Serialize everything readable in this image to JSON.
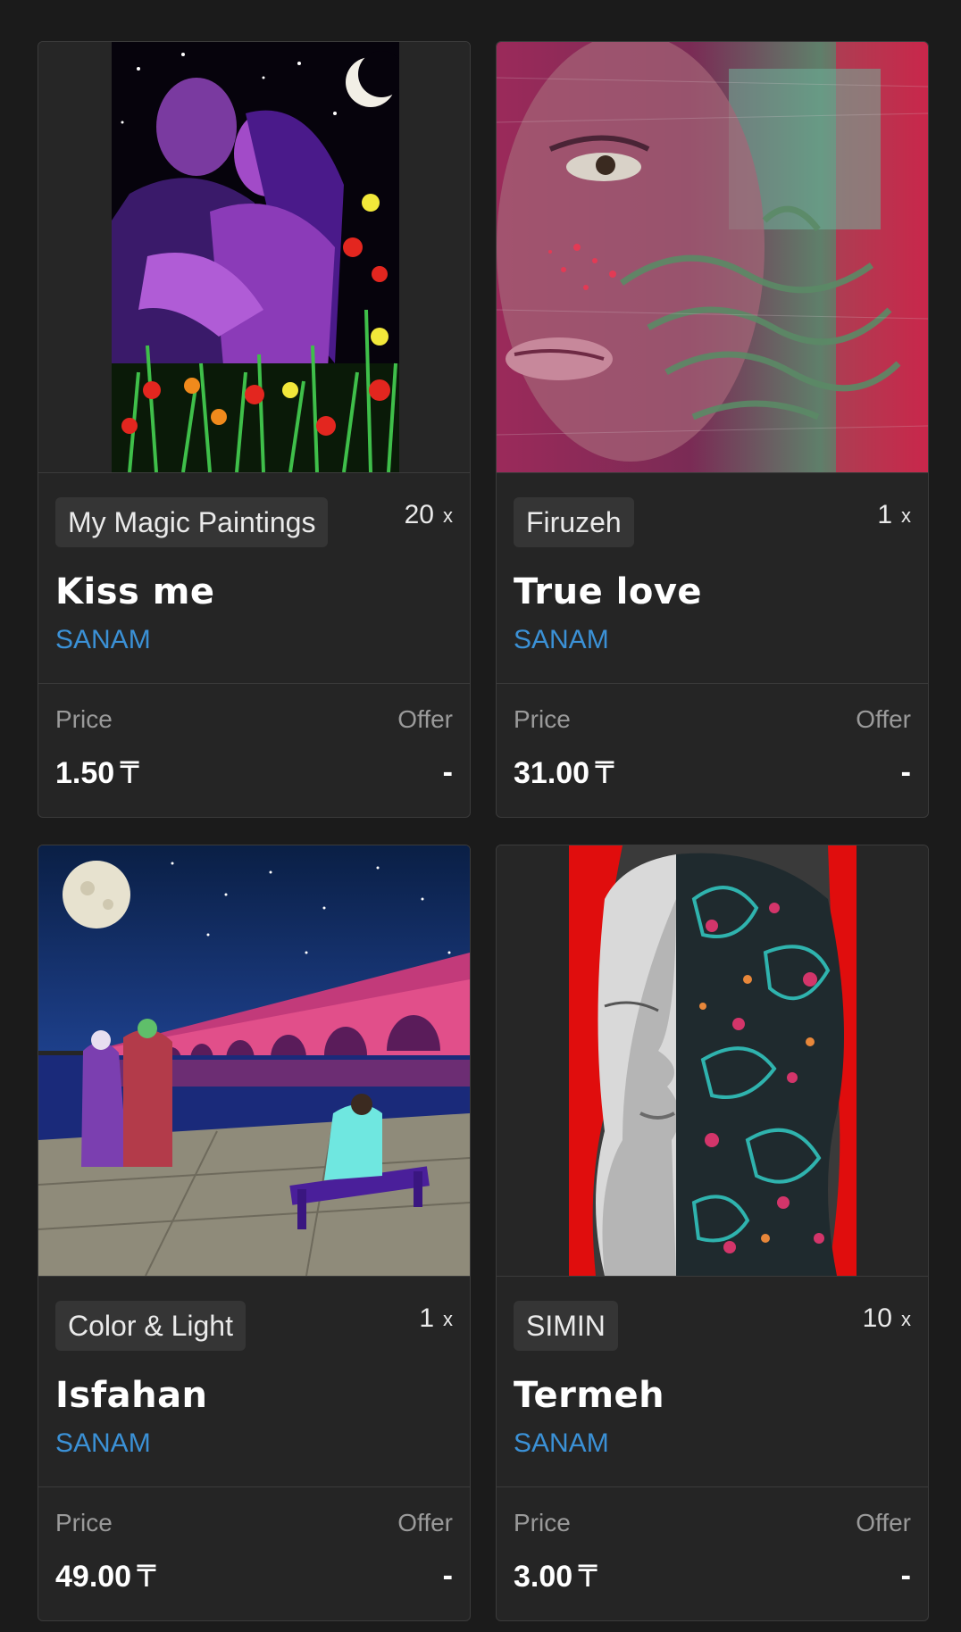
{
  "labels": {
    "price": "Price",
    "offer": "Offer",
    "qty_suffix": "x"
  },
  "cards": [
    {
      "collection": "My Magic Paintings",
      "quantity": "20",
      "title": "Kiss me",
      "artist": "SANAM",
      "price": "1.50",
      "currency": "₸",
      "offer": "-",
      "artwork": "couple-embracing-night-flowers-painting"
    },
    {
      "collection": "Firuzeh",
      "quantity": "1",
      "title": "True love",
      "artist": "SANAM",
      "price": "31.00",
      "currency": "₸",
      "offer": "-",
      "artwork": "face-with-persian-calligraphy-painting"
    },
    {
      "collection": "Color & Light",
      "quantity": "1",
      "title": "Isfahan",
      "artist": "SANAM",
      "price": "49.00",
      "currency": "₸",
      "offer": "-",
      "artwork": "bridge-at-night-with-moon-painting"
    },
    {
      "collection": "SIMIN",
      "quantity": "10",
      "title": "Termeh",
      "artist": "SANAM",
      "price": "3.00",
      "currency": "₸",
      "offer": "-",
      "artwork": "half-face-paisley-pattern-painting"
    }
  ],
  "colors": {
    "link": "#3b91d6",
    "card_bg": "#252525",
    "page_bg": "#1b1b1b",
    "badge_bg": "#353535"
  }
}
